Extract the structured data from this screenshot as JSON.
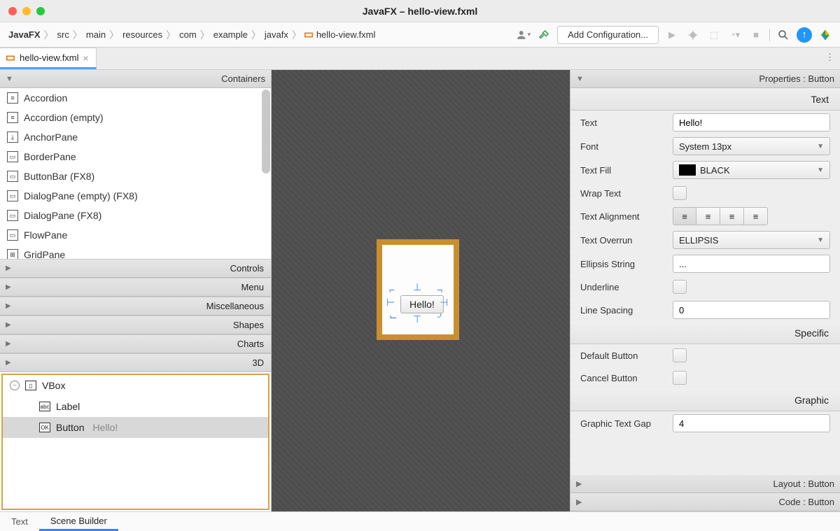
{
  "window": {
    "title": "JavaFX – hello-view.fxml"
  },
  "breadcrumbs": [
    "JavaFX",
    "src",
    "main",
    "resources",
    "com",
    "example",
    "javafx",
    "hello-view.fxml"
  ],
  "toolbar": {
    "configure": "Add Configuration..."
  },
  "tab": {
    "filename": "hello-view.fxml"
  },
  "library": {
    "header": "Containers",
    "items": [
      "Accordion",
      "Accordion  (empty)",
      "AnchorPane",
      "BorderPane",
      "ButtonBar  (FX8)",
      "DialogPane (empty)  (FX8)",
      "DialogPane  (FX8)",
      "FlowPane",
      "GridPane"
    ],
    "sections": [
      "Controls",
      "Menu",
      "Miscellaneous",
      "Shapes",
      "Charts",
      "3D"
    ]
  },
  "hierarchy": {
    "root": "VBox",
    "children": [
      {
        "type": "Label",
        "text": ""
      },
      {
        "type": "Button",
        "text": "Hello!"
      }
    ]
  },
  "canvas": {
    "buttonText": "Hello!"
  },
  "properties": {
    "title": "Properties : Button",
    "sections": {
      "text": {
        "header": "Text",
        "text_label": "Text",
        "text_value": "Hello!",
        "font_label": "Font",
        "font_value": "System 13px",
        "fill_label": "Text Fill",
        "fill_value": "BLACK",
        "wrap_label": "Wrap Text",
        "align_label": "Text Alignment",
        "overrun_label": "Text Overrun",
        "overrun_value": "ELLIPSIS",
        "ellipsis_label": "Ellipsis String",
        "ellipsis_value": "...",
        "underline_label": "Underline",
        "spacing_label": "Line Spacing",
        "spacing_value": "0"
      },
      "specific": {
        "header": "Specific",
        "default_label": "Default Button",
        "cancel_label": "Cancel Button"
      },
      "graphic": {
        "header": "Graphic",
        "gap_label": "Graphic Text Gap",
        "gap_value": "4"
      },
      "layout": "Layout : Button",
      "code": "Code : Button"
    }
  },
  "footer": {
    "tab1": "Text",
    "tab2": "Scene Builder"
  }
}
